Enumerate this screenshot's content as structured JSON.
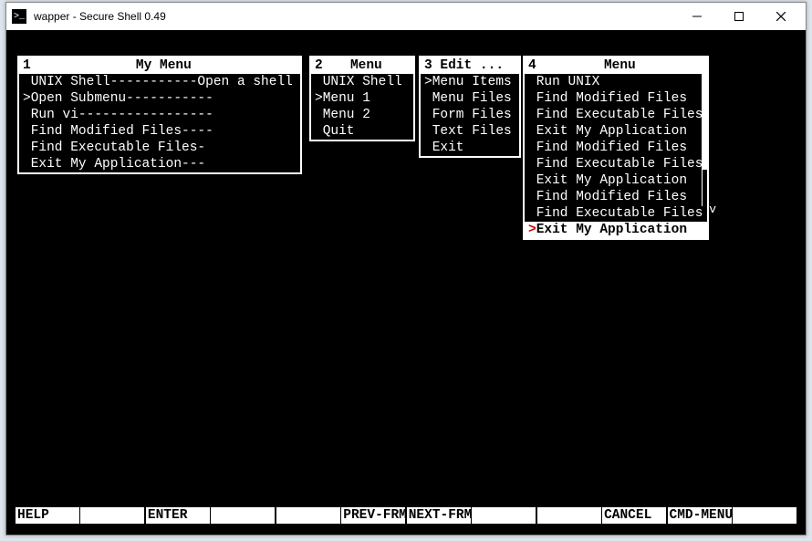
{
  "window": {
    "title": "wapper - Secure Shell 0.49"
  },
  "menus": [
    {
      "id": 1,
      "num": "1",
      "title": "My Menu",
      "items": [
        {
          "text": "UNIX Shell-----------Open a shell",
          "marker": " "
        },
        {
          "text": "Open Submenu-----------",
          "marker": ">"
        },
        {
          "text": "Run vi-----------------",
          "marker": " "
        },
        {
          "text": "Find Modified Files----",
          "marker": " "
        },
        {
          "text": "Find Executable Files-",
          "marker": " "
        },
        {
          "text": "Exit My Application---",
          "marker": " "
        }
      ]
    },
    {
      "id": 2,
      "num": "2",
      "title": "Menu",
      "items": [
        {
          "text": "UNIX Shell",
          "marker": " "
        },
        {
          "text": "Menu 1",
          "marker": ">"
        },
        {
          "text": "Menu 2",
          "marker": " "
        },
        {
          "text": "Quit",
          "marker": " "
        }
      ]
    },
    {
      "id": 3,
      "num": "3",
      "title": "Edit ...",
      "items": [
        {
          "text": "Menu Items",
          "marker": ">"
        },
        {
          "text": "Menu Files",
          "marker": " "
        },
        {
          "text": "Form Files",
          "marker": " "
        },
        {
          "text": "Text Files",
          "marker": " "
        },
        {
          "text": "Exit",
          "marker": " "
        }
      ]
    },
    {
      "id": 4,
      "num": "4",
      "title": "Menu",
      "items": [
        {
          "text": "Run UNIX",
          "marker": " "
        },
        {
          "text": "Find Modified Files",
          "marker": " "
        },
        {
          "text": "Find Executable Files",
          "marker": " "
        },
        {
          "text": "Exit My Application",
          "marker": " "
        },
        {
          "text": "Find Modified Files",
          "marker": " "
        },
        {
          "text": "Find Executable Files",
          "marker": " "
        },
        {
          "text": "Exit My Application",
          "marker": " "
        },
        {
          "text": "Find Modified Files",
          "marker": " "
        },
        {
          "text": "Find Executable Files",
          "marker": " "
        },
        {
          "text": "Exit My Application",
          "marker": ">",
          "selected": true
        }
      ]
    }
  ],
  "footer": {
    "keys": [
      "HELP",
      "",
      "ENTER",
      "",
      "",
      "PREV-FRM",
      "NEXT-FRM",
      "",
      "",
      "CANCEL",
      "CMD-MENU",
      ""
    ]
  }
}
